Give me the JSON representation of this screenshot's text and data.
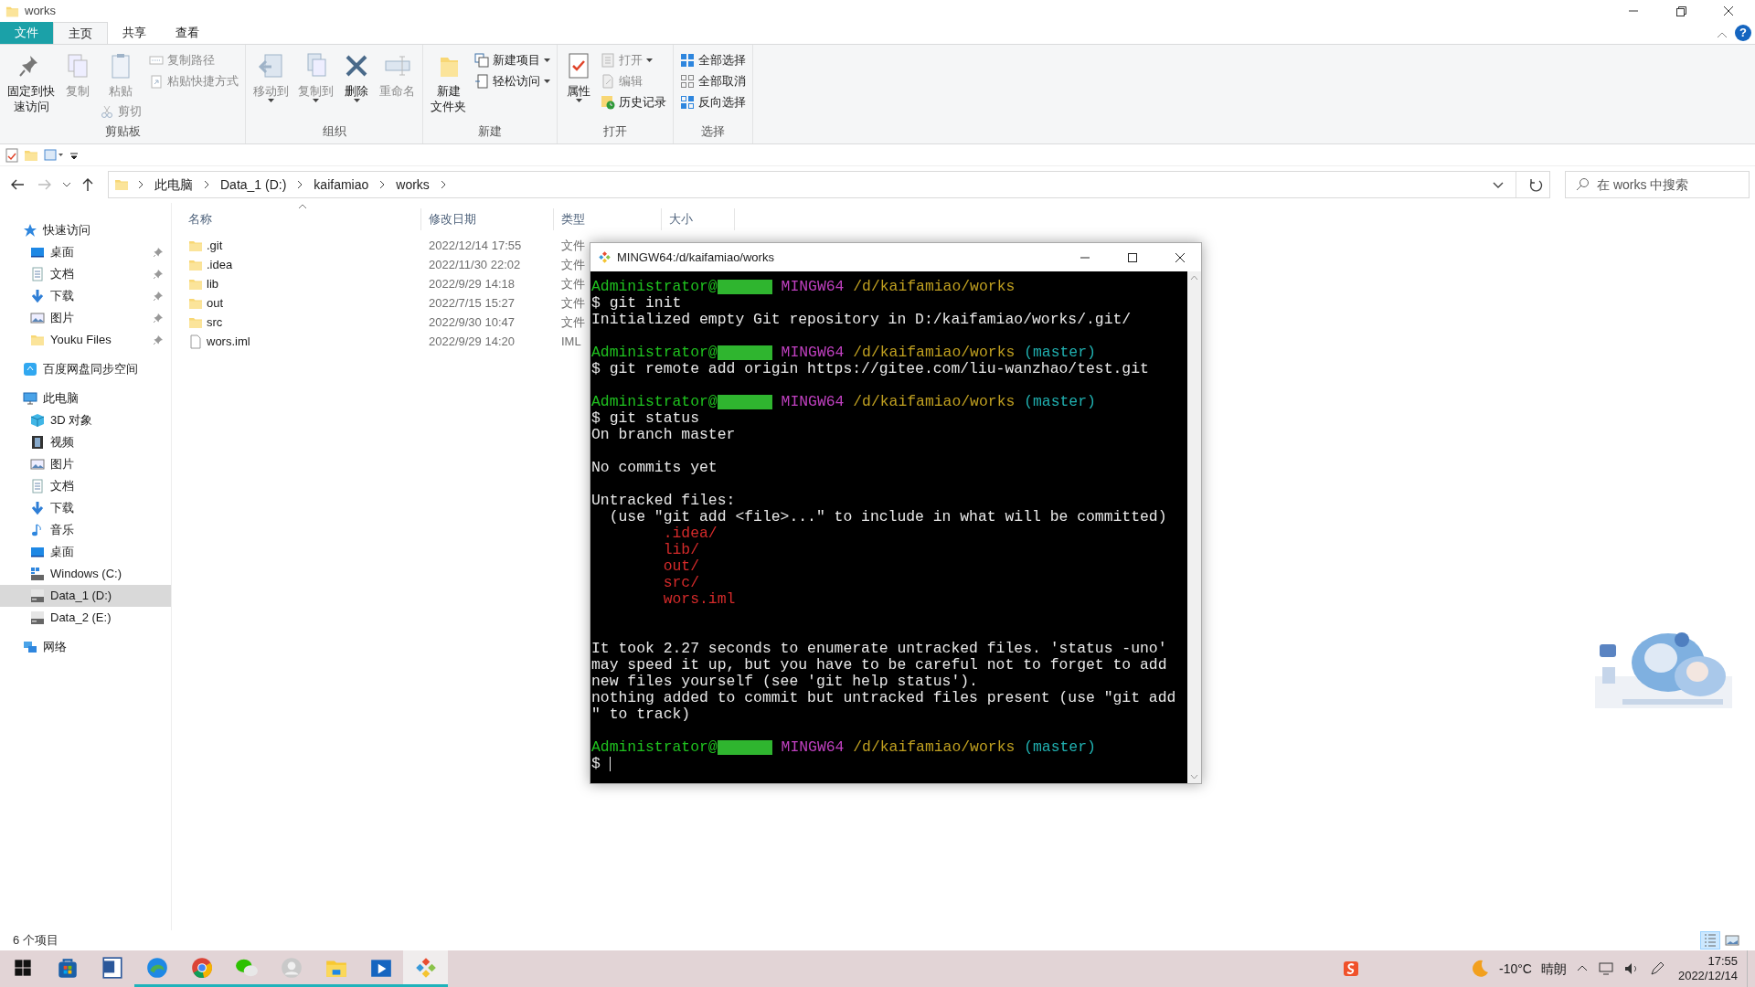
{
  "window": {
    "title": "works"
  },
  "ribbon_tabs": [
    {
      "label": "文件",
      "kind": "file",
      "selected": false
    },
    {
      "label": "主页",
      "kind": "tab",
      "selected": true
    },
    {
      "label": "共享",
      "kind": "tab",
      "selected": false
    },
    {
      "label": "查看",
      "kind": "tab",
      "selected": false
    }
  ],
  "help": "?",
  "ribbon_groups": [
    {
      "label": "剪贴板",
      "columns": [
        {
          "items": [
            {
              "label_lines": [
                "固定到快",
                "速访问"
              ],
              "kind": "large",
              "disabled": false,
              "dropdown": false
            }
          ]
        },
        {
          "items": [
            {
              "label_lines": [
                "复制"
              ],
              "kind": "large",
              "disabled": true,
              "dropdown": false
            }
          ]
        },
        {
          "items": [
            {
              "label_lines": [
                "粘贴"
              ],
              "kind": "large",
              "disabled": true,
              "dropdown": false
            },
            {
              "label_lines": [
                "剪切"
              ],
              "kind": "small",
              "disabled": true,
              "dropdown": false
            }
          ]
        },
        {
          "items": [
            {
              "label_lines": [
                "复制路径"
              ],
              "kind": "small",
              "disabled": true,
              "dropdown": false
            },
            {
              "label_lines": [
                "粘贴快捷方式"
              ],
              "kind": "small",
              "disabled": true,
              "dropdown": false
            }
          ]
        }
      ]
    },
    {
      "label": "组织",
      "columns": [
        {
          "items": [
            {
              "label_lines": [
                "移动到"
              ],
              "kind": "large",
              "disabled": true,
              "dropdown": true
            }
          ]
        },
        {
          "items": [
            {
              "label_lines": [
                "复制到"
              ],
              "kind": "large",
              "disabled": true,
              "dropdown": true
            }
          ]
        },
        {
          "items": [
            {
              "label_lines": [
                "删除"
              ],
              "kind": "large",
              "disabled": false,
              "dropdown": true
            }
          ]
        },
        {
          "items": [
            {
              "label_lines": [
                "重命名"
              ],
              "kind": "large",
              "disabled": true,
              "dropdown": false
            }
          ]
        }
      ]
    },
    {
      "label": "新建",
      "columns": [
        {
          "items": [
            {
              "label_lines": [
                "新建",
                "文件夹"
              ],
              "kind": "large",
              "disabled": false,
              "dropdown": false
            }
          ]
        },
        {
          "items": [
            {
              "label_lines": [
                "新建项目"
              ],
              "kind": "small",
              "disabled": false,
              "dropdown": true
            },
            {
              "label_lines": [
                "轻松访问"
              ],
              "kind": "small",
              "disabled": false,
              "dropdown": true
            }
          ]
        }
      ]
    },
    {
      "label": "打开",
      "columns": [
        {
          "items": [
            {
              "label_lines": [
                "属性"
              ],
              "kind": "large",
              "disabled": false,
              "dropdown": true
            }
          ]
        },
        {
          "items": [
            {
              "label_lines": [
                "打开"
              ],
              "kind": "small",
              "disabled": true,
              "dropdown": true
            },
            {
              "label_lines": [
                "编辑"
              ],
              "kind": "small",
              "disabled": true,
              "dropdown": false
            },
            {
              "label_lines": [
                "历史记录"
              ],
              "kind": "small",
              "disabled": false,
              "dropdown": false
            }
          ]
        }
      ]
    },
    {
      "label": "选择",
      "columns": [
        {
          "items": [
            {
              "label_lines": [
                "全部选择"
              ],
              "kind": "small",
              "disabled": false,
              "dropdown": false
            },
            {
              "label_lines": [
                "全部取消"
              ],
              "kind": "small",
              "disabled": false,
              "dropdown": false
            },
            {
              "label_lines": [
                "反向选择"
              ],
              "kind": "small",
              "disabled": false,
              "dropdown": false
            }
          ]
        }
      ]
    }
  ],
  "breadcrumb": [
    "此电脑",
    "Data_1 (D:)",
    "kaifamiao",
    "works"
  ],
  "search": {
    "placeholder": "在 works 中搜索"
  },
  "sidebar": {
    "items": [
      {
        "label": "快速访问",
        "selected": false,
        "children": [
          {
            "label": "桌面",
            "pinned": true,
            "selected": false
          },
          {
            "label": "文档",
            "pinned": true,
            "selected": false
          },
          {
            "label": "下载",
            "pinned": true,
            "selected": false
          },
          {
            "label": "图片",
            "pinned": true,
            "selected": false
          },
          {
            "label": "Youku Files",
            "pinned": true,
            "selected": false
          }
        ]
      },
      {
        "label": "百度网盘同步空间",
        "selected": false
      },
      {
        "label": "此电脑",
        "selected": false,
        "children": [
          {
            "label": "3D 对象",
            "pinned": false,
            "selected": false
          },
          {
            "label": "视频",
            "pinned": false,
            "selected": false
          },
          {
            "label": "图片",
            "pinned": false,
            "selected": false
          },
          {
            "label": "文档",
            "pinned": false,
            "selected": false
          },
          {
            "label": "下载",
            "pinned": false,
            "selected": false
          },
          {
            "label": "音乐",
            "pinned": false,
            "selected": false
          },
          {
            "label": "桌面",
            "pinned": false,
            "selected": false
          },
          {
            "label": "Windows (C:)",
            "pinned": false,
            "selected": false
          },
          {
            "label": "Data_1 (D:)",
            "pinned": false,
            "selected": true
          },
          {
            "label": "Data_2 (E:)",
            "pinned": false,
            "selected": false
          }
        ]
      },
      {
        "label": "网络",
        "selected": false
      }
    ]
  },
  "file_list": {
    "columns": [
      "名称",
      "修改日期",
      "类型",
      "大小"
    ],
    "rows": [
      {
        "kind": "folder",
        "name": ".git",
        "date": "2022/12/14 17:55",
        "type": "文件"
      },
      {
        "kind": "folder",
        "name": ".idea",
        "date": "2022/11/30 22:02",
        "type": "文件"
      },
      {
        "kind": "folder",
        "name": "lib",
        "date": "2022/9/29 14:18",
        "type": "文件"
      },
      {
        "kind": "folder",
        "name": "out",
        "date": "2022/7/15 15:27",
        "type": "文件"
      },
      {
        "kind": "folder",
        "name": "src",
        "date": "2022/9/30 10:47",
        "type": "文件"
      },
      {
        "kind": "file",
        "name": "wors.iml",
        "date": "2022/9/29 14:20",
        "type": "IML"
      }
    ]
  },
  "status_bar": {
    "count": "6 个项目",
    "views": [
      {
        "kind": "details",
        "selected": true
      },
      {
        "kind": "large-icons",
        "selected": false
      }
    ]
  },
  "terminal": {
    "title": "MINGW64:/d/kaifamiao/works",
    "cursor": true,
    "lines": [
      {
        "kind": "text",
        "spans": [
          {
            "kind": "text",
            "text": "Administrator@",
            "color": "#1fc21f"
          },
          {
            "kind": "redacted"
          },
          {
            "kind": "text",
            "text": " MINGW64 ",
            "color": "#c040c0"
          },
          {
            "kind": "text",
            "text": "/d/kaifamiao/works",
            "color": "#c0a020"
          }
        ]
      },
      {
        "kind": "text",
        "spans": [
          {
            "kind": "text",
            "text": "$ git init",
            "color": "#e8e8e8"
          }
        ]
      },
      {
        "kind": "text",
        "spans": [
          {
            "kind": "text",
            "text": "Initialized empty Git repository in D:/kaifamiao/works/.git/",
            "color": "#e8e8e8"
          }
        ]
      },
      {
        "kind": "blank"
      },
      {
        "kind": "text",
        "spans": [
          {
            "kind": "text",
            "text": "Administrator@",
            "color": "#1fc21f"
          },
          {
            "kind": "redacted"
          },
          {
            "kind": "text",
            "text": " MINGW64 ",
            "color": "#c040c0"
          },
          {
            "kind": "text",
            "text": "/d/kaifamiao/works",
            "color": "#c0a020"
          },
          {
            "kind": "text",
            "text": " (master)",
            "color": "#20b0b0"
          }
        ]
      },
      {
        "kind": "text",
        "spans": [
          {
            "kind": "text",
            "text": "$ git remote add origin https://gitee.com/liu-wanzhao/test.git",
            "color": "#e8e8e8"
          }
        ]
      },
      {
        "kind": "blank"
      },
      {
        "kind": "text",
        "spans": [
          {
            "kind": "text",
            "text": "Administrator@",
            "color": "#1fc21f"
          },
          {
            "kind": "redacted"
          },
          {
            "kind": "text",
            "text": " MINGW64 ",
            "color": "#c040c0"
          },
          {
            "kind": "text",
            "text": "/d/kaifamiao/works",
            "color": "#c0a020"
          },
          {
            "kind": "text",
            "text": " (master)",
            "color": "#20b0b0"
          }
        ]
      },
      {
        "kind": "text",
        "spans": [
          {
            "kind": "text",
            "text": "$ git status",
            "color": "#e8e8e8"
          }
        ]
      },
      {
        "kind": "text",
        "spans": [
          {
            "kind": "text",
            "text": "On branch master",
            "color": "#e8e8e8"
          }
        ]
      },
      {
        "kind": "blank"
      },
      {
        "kind": "text",
        "spans": [
          {
            "kind": "text",
            "text": "No commits yet",
            "color": "#e8e8e8"
          }
        ]
      },
      {
        "kind": "blank"
      },
      {
        "kind": "text",
        "spans": [
          {
            "kind": "text",
            "text": "Untracked files:",
            "color": "#e8e8e8"
          }
        ]
      },
      {
        "kind": "text",
        "spans": [
          {
            "kind": "text",
            "text": "  (use \"git add <file>...\" to include in what will be committed)",
            "color": "#e8e8e8"
          }
        ]
      },
      {
        "kind": "text",
        "spans": [
          {
            "kind": "text",
            "text": "        .idea/",
            "color": "#d42a2a"
          }
        ]
      },
      {
        "kind": "text",
        "spans": [
          {
            "kind": "text",
            "text": "        lib/",
            "color": "#d42a2a"
          }
        ]
      },
      {
        "kind": "text",
        "spans": [
          {
            "kind": "text",
            "text": "        out/",
            "color": "#d42a2a"
          }
        ]
      },
      {
        "kind": "text",
        "spans": [
          {
            "kind": "text",
            "text": "        src/",
            "color": "#d42a2a"
          }
        ]
      },
      {
        "kind": "text",
        "spans": [
          {
            "kind": "text",
            "text": "        wors.iml",
            "color": "#d42a2a"
          }
        ]
      },
      {
        "kind": "blank"
      },
      {
        "kind": "blank"
      },
      {
        "kind": "text",
        "spans": [
          {
            "kind": "text",
            "text": "It took 2.27 seconds to enumerate untracked files. 'status -uno'",
            "color": "#e8e8e8"
          }
        ]
      },
      {
        "kind": "text",
        "spans": [
          {
            "kind": "text",
            "text": "may speed it up, but you have to be careful not to forget to add",
            "color": "#e8e8e8"
          }
        ]
      },
      {
        "kind": "text",
        "spans": [
          {
            "kind": "text",
            "text": "new files yourself (see 'git help status').",
            "color": "#e8e8e8"
          }
        ]
      },
      {
        "kind": "text",
        "spans": [
          {
            "kind": "text",
            "text": "nothing added to commit but untracked files present (use \"git add",
            "color": "#e8e8e8"
          }
        ]
      },
      {
        "kind": "text",
        "spans": [
          {
            "kind": "text",
            "text": "\" to track)",
            "color": "#e8e8e8"
          }
        ]
      },
      {
        "kind": "blank"
      },
      {
        "kind": "text",
        "spans": [
          {
            "kind": "text",
            "text": "Administrator@",
            "color": "#1fc21f"
          },
          {
            "kind": "redacted"
          },
          {
            "kind": "text",
            "text": " MINGW64 ",
            "color": "#c040c0"
          },
          {
            "kind": "text",
            "text": "/d/kaifamiao/works",
            "color": "#c0a020"
          },
          {
            "kind": "text",
            "text": " (master)",
            "color": "#20b0b0"
          }
        ]
      },
      {
        "kind": "prompt",
        "spans": [
          {
            "kind": "text",
            "text": "$ ",
            "color": "#e8e8e8"
          }
        ]
      }
    ]
  },
  "taskbar": {
    "apps": [
      {
        "running": false,
        "selected": false
      },
      {
        "running": false,
        "selected": false
      },
      {
        "running": false,
        "selected": false
      },
      {
        "running": true,
        "selected": false
      },
      {
        "running": true,
        "selected": false
      },
      {
        "running": true,
        "selected": false
      },
      {
        "running": true,
        "selected": false
      },
      {
        "running": true,
        "selected": false
      },
      {
        "running": true,
        "selected": false
      },
      {
        "running": true,
        "selected": true
      }
    ],
    "weather": {
      "temperature": "-10°C",
      "condition": "晴朗"
    },
    "clock": {
      "time": "17:55",
      "date": "2022/12/14"
    }
  },
  "widget": {
    "kind": "picture"
  }
}
